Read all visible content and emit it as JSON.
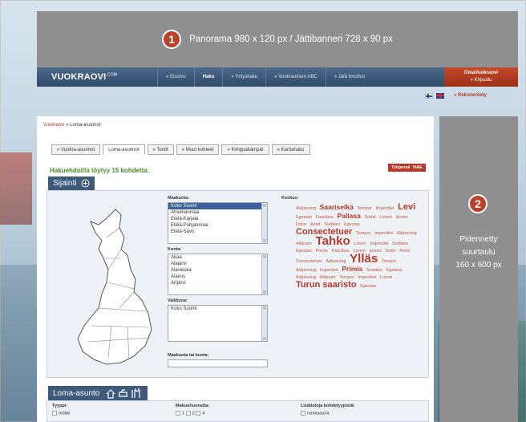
{
  "panorama": {
    "number": "1",
    "text": "Panorama 980 x 120 px / Jättibanneri 728 x 90 px"
  },
  "nav": {
    "logo": "VUOKRAOVI",
    "logo_suffix": ".COM",
    "items": [
      "» Etusivu",
      "Haku",
      "» Yrityshaku",
      "» Vuokrauksen ABC",
      "» Jätä ilmoitus"
    ],
    "account_title": "OmaVuokraovi",
    "account_login": "» Kirjaudu",
    "register": "» Rekisteröidy"
  },
  "breadcrumb": {
    "root": "Vuokraovi",
    "current": "» Loma-asunnot"
  },
  "tabs": [
    "» Vuokra-asunnot",
    "Loma-asunnot",
    "» Tontit",
    "» Muut kohteet",
    "» Kimppakämpät",
    "» Karttahaku"
  ],
  "results_text": "Hakuehdoilla löytyy 15 kohdetta.",
  "buttons": {
    "clear": "Tyhjennä",
    "search": "HAE"
  },
  "location": {
    "heading": "Sijainti",
    "region_label": "Maakunta:",
    "regions": [
      "Koko Suomi",
      "Ahvenanmaa",
      "Etelä-Karjala",
      "Etelä-Pohjanmaa",
      "Etelä-Savo"
    ],
    "municipality_label": "Kunta:",
    "municipalities": [
      "Akaa",
      "Alajärvi",
      "Alavieska",
      "Alavus",
      "Artjärvi"
    ],
    "selected_label": "Valittuna:",
    "selected": "Koko Suomi",
    "free_label": "Maakunta tai kunta:",
    "center_label": "Keskus:"
  },
  "tag_cloud": [
    {
      "text": "Adipiscing",
      "size": "s"
    },
    {
      "text": "Saariselkä",
      "size": "m"
    },
    {
      "text": "Tempor",
      "size": "s"
    },
    {
      "text": "Imperdiet",
      "size": "s"
    },
    {
      "text": "Levi",
      "size": "l"
    },
    {
      "text": "Egestas",
      "size": "s"
    },
    {
      "text": "Faucibus",
      "size": "s"
    },
    {
      "text": "Pallasa",
      "size": "m"
    },
    {
      "text": "Sodal",
      "size": "s"
    },
    {
      "text": "Lorem",
      "size": "s"
    },
    {
      "text": "Ipsum",
      "size": "s"
    },
    {
      "text": "Dolor",
      "size": "s"
    },
    {
      "text": "Amet",
      "size": "s"
    },
    {
      "text": "Sodales",
      "size": "s"
    },
    {
      "text": "Egestas",
      "size": "s"
    },
    {
      "text": "Consectetuer",
      "size": "l"
    },
    {
      "text": "Tempor",
      "size": "s"
    },
    {
      "text": "Imperdiet",
      "size": "s"
    },
    {
      "text": "Adipiscing",
      "size": "s"
    },
    {
      "text": "Aliquam",
      "size": "s"
    },
    {
      "text": "Tahko",
      "size": "xl"
    },
    {
      "text": "Lorem",
      "size": "s"
    },
    {
      "text": "Imperdiet",
      "size": "s"
    },
    {
      "text": "Sodales",
      "size": "s"
    },
    {
      "text": "Egestas",
      "size": "s"
    },
    {
      "text": "Primis",
      "size": "s"
    },
    {
      "text": "Faucibus",
      "size": "s"
    },
    {
      "text": "Lorem",
      "size": "s"
    },
    {
      "text": "Ipsum",
      "size": "s"
    },
    {
      "text": "Dolor",
      "size": "s"
    },
    {
      "text": "Amet",
      "size": "s"
    },
    {
      "text": "Consectetuer",
      "size": "s"
    },
    {
      "text": "Adipiscing",
      "size": "s"
    },
    {
      "text": "Ylläs",
      "size": "xl"
    },
    {
      "text": "Tempor",
      "size": "s"
    },
    {
      "text": "Adipiscing",
      "size": "s"
    },
    {
      "text": "Imperdiet",
      "size": "s"
    },
    {
      "text": "Primis",
      "size": "m"
    },
    {
      "text": "Sodales",
      "size": "s"
    },
    {
      "text": "Egestas",
      "size": "s"
    },
    {
      "text": "Adipiscing",
      "size": "s"
    },
    {
      "text": "Aliquam",
      "size": "s"
    },
    {
      "text": "Tempor",
      "size": "s"
    },
    {
      "text": "Imperdiet",
      "size": "s"
    },
    {
      "text": "Lorem",
      "size": "s"
    },
    {
      "text": "Turun saaristo",
      "size": "l"
    },
    {
      "text": "Egestas",
      "size": "s"
    }
  ],
  "side_ad": {
    "number": "2",
    "lines": [
      "Pidennetty",
      "suurtaulu",
      "160 x 600 px"
    ]
  },
  "loma": {
    "heading": "Loma-asunto",
    "type_label": "Tyyppi:",
    "type_first": "mökki",
    "rooms_label": "Makuuhuoneita:",
    "rooms": [
      "1",
      "2",
      "4"
    ],
    "extra_label": "Lisätietoja kohdetyypistä:",
    "extra_first": "rantasauna"
  }
}
